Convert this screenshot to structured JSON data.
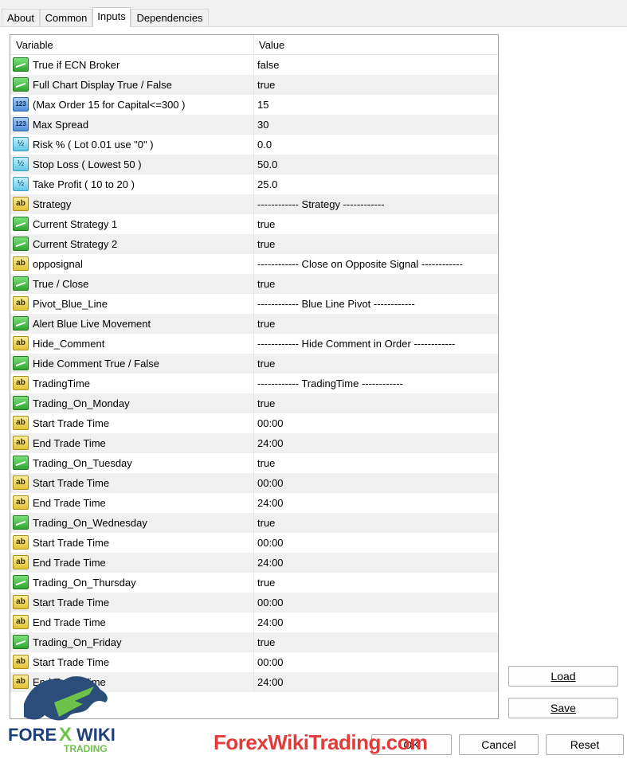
{
  "tabs": [
    {
      "label": "About"
    },
    {
      "label": "Common"
    },
    {
      "label": "Inputs"
    },
    {
      "label": "Dependencies"
    }
  ],
  "active_tab": "Inputs",
  "table": {
    "col_variable": "Variable",
    "col_value": "Value",
    "rows": [
      {
        "icon": "bool",
        "name": "True if ECN Broker",
        "value": "false"
      },
      {
        "icon": "bool",
        "name": "Full Chart Display True / False",
        "value": "true"
      },
      {
        "icon": "int",
        "name": "(Max Order 15 for Capital<=300 )",
        "value": "15"
      },
      {
        "icon": "int",
        "name": "Max Spread",
        "value": "30"
      },
      {
        "icon": "double",
        "name": "Risk % ( Lot 0.01 use \"0\" )",
        "value": "0.0"
      },
      {
        "icon": "double",
        "name": "Stop Loss ( Lowest 50 )",
        "value": "50.0"
      },
      {
        "icon": "double",
        "name": "Take Profit ( 10 to 20 )",
        "value": "25.0"
      },
      {
        "icon": "string",
        "name": "Strategy",
        "value": "------------ Strategy ------------"
      },
      {
        "icon": "bool",
        "name": "Current Strategy 1",
        "value": "true"
      },
      {
        "icon": "bool",
        "name": "Current Strategy 2",
        "value": "true"
      },
      {
        "icon": "string",
        "name": "opposignal",
        "value": "------------ Close on Opposite Signal ------------"
      },
      {
        "icon": "bool",
        "name": "True / Close",
        "value": "true"
      },
      {
        "icon": "string",
        "name": "Pivot_Blue_Line",
        "value": "------------ Blue Line Pivot ------------"
      },
      {
        "icon": "bool",
        "name": "Alert Blue Live Movement",
        "value": "true"
      },
      {
        "icon": "string",
        "name": "Hide_Comment",
        "value": "------------ Hide Comment in Order  ------------"
      },
      {
        "icon": "bool",
        "name": "Hide Comment True / False",
        "value": "true"
      },
      {
        "icon": "string",
        "name": "TradingTime",
        "value": "------------ TradingTime ------------"
      },
      {
        "icon": "bool",
        "name": "Trading_On_Monday",
        "value": "true"
      },
      {
        "icon": "string",
        "name": "Start Trade Time",
        "value": "00:00"
      },
      {
        "icon": "string",
        "name": "End Trade Time",
        "value": "24:00"
      },
      {
        "icon": "bool",
        "name": "Trading_On_Tuesday",
        "value": "true"
      },
      {
        "icon": "string",
        "name": "Start Trade Time",
        "value": "00:00"
      },
      {
        "icon": "string",
        "name": "End Trade Time",
        "value": "24:00"
      },
      {
        "icon": "bool",
        "name": "Trading_On_Wednesday",
        "value": "true"
      },
      {
        "icon": "string",
        "name": "Start Trade Time",
        "value": "00:00"
      },
      {
        "icon": "string",
        "name": "End Trade Time",
        "value": "24:00"
      },
      {
        "icon": "bool",
        "name": "Trading_On_Thursday",
        "value": "true"
      },
      {
        "icon": "string",
        "name": "Start Trade Time",
        "value": "00:00"
      },
      {
        "icon": "string",
        "name": "End Trade Time",
        "value": "24:00"
      },
      {
        "icon": "bool",
        "name": "Trading_On_Friday",
        "value": "true"
      },
      {
        "icon": "string",
        "name": "Start Trade Time",
        "value": "00:00"
      },
      {
        "icon": "string",
        "name": "End Trade Time",
        "value": "24:00"
      }
    ]
  },
  "icon_glyphs": {
    "int": "123",
    "double": "½",
    "string": "ab"
  },
  "buttons": {
    "load": "Load",
    "save": "Save",
    "ok": "OK",
    "cancel": "Cancel",
    "reset": "Reset"
  },
  "watermark": {
    "logo_text": "FOREX WIKI TRADING",
    "site": "ForexWikiTrading.com",
    "color": "#e33a3a"
  }
}
